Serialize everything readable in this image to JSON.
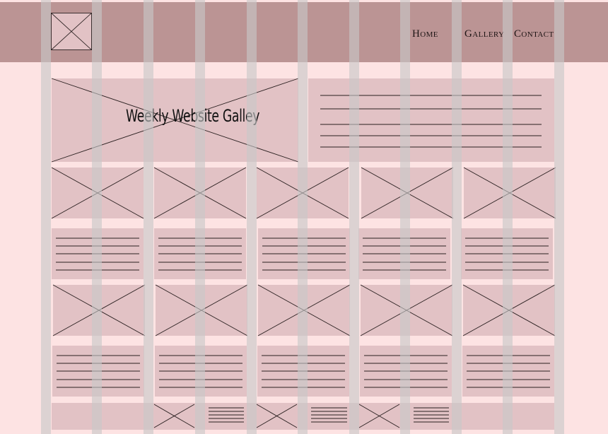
{
  "nav": {
    "home": "Home",
    "gallery": "Gallery",
    "contact": "Contact"
  },
  "hero": {
    "title": "Weekly Website Galley"
  },
  "icons": {
    "logo": "image-placeholder-icon",
    "hero": "image-placeholder-icon",
    "gallery_thumb": "image-placeholder-icon",
    "text": "text-lines-placeholder"
  },
  "colors": {
    "page_background": "#fde3e3",
    "header_background": "#bb9494",
    "block_fill": "#e2c2c5",
    "grid_column": "#c8c8c8"
  }
}
